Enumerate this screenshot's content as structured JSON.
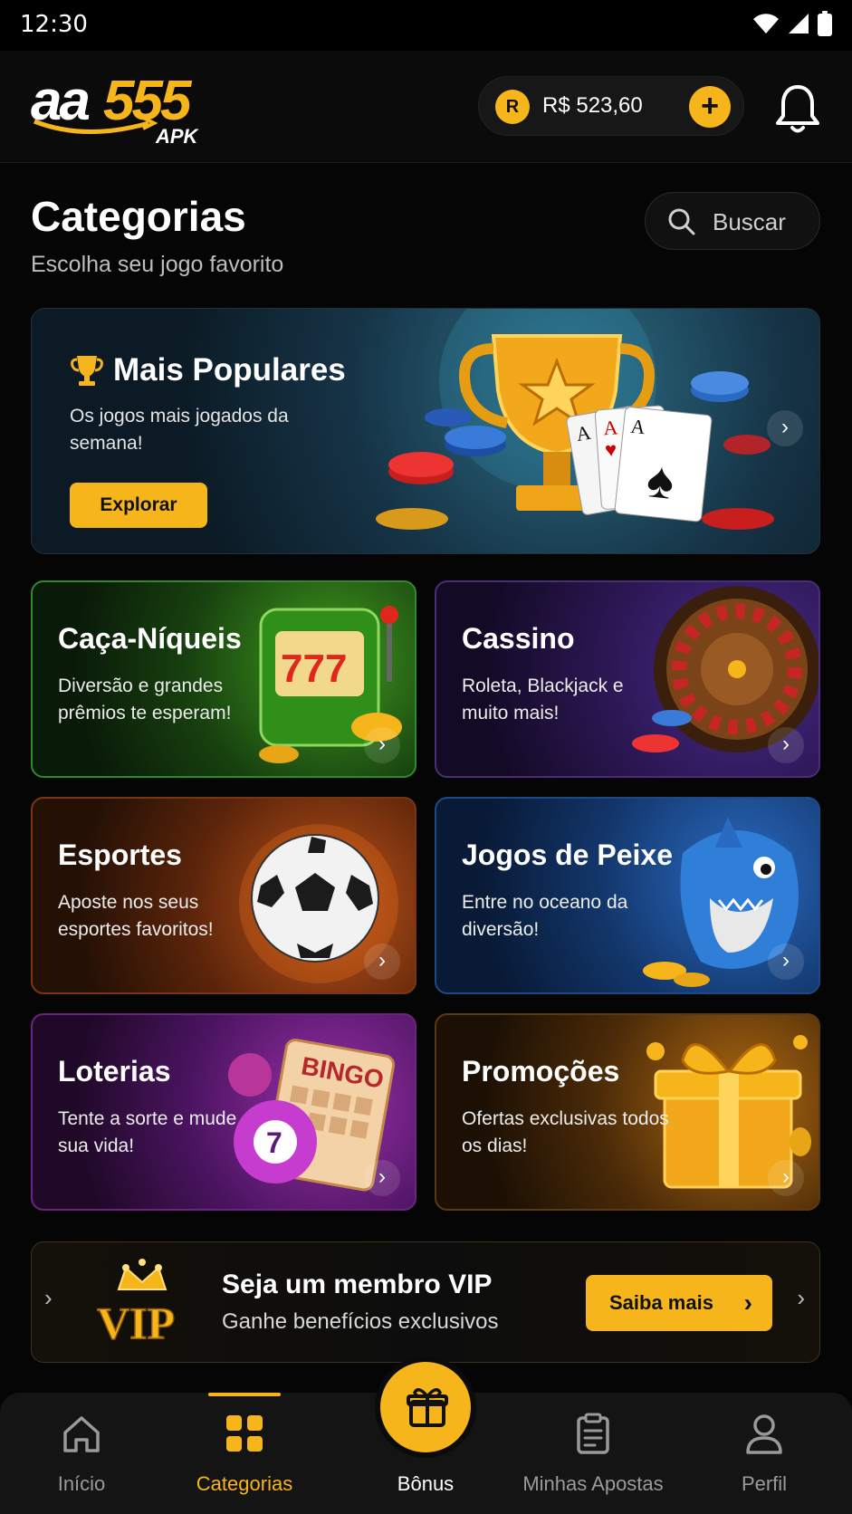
{
  "status_bar": {
    "time": "12:30"
  },
  "header": {
    "logo": {
      "part1": "aa",
      "part2": "555",
      "sub": "APK"
    },
    "balance": {
      "coin_letter": "R",
      "value": "R$ 523,60",
      "add_symbol": "+"
    }
  },
  "page": {
    "title": "Categorias",
    "subtitle": "Escolha seu jogo favorito"
  },
  "search": {
    "label": "Buscar"
  },
  "hero": {
    "title": "Mais Populares",
    "description": "Os jogos mais jogados da semana!",
    "button": "Explorar"
  },
  "categories": [
    {
      "title": "Caça-Níqueis",
      "description": "Diversão e grandes prêmios te esperam!"
    },
    {
      "title": "Cassino",
      "description": "Roleta, Blackjack e muito mais!"
    },
    {
      "title": "Esportes",
      "description": "Aposte nos seus esportes favoritos!"
    },
    {
      "title": "Jogos de Peixe",
      "description": "Entre no oceano da diversão!"
    },
    {
      "title": "Loterias",
      "description": "Tente a sorte e mude sua vida!"
    },
    {
      "title": "Promoções",
      "description": "Ofertas exclusivas todos os dias!"
    }
  ],
  "vip": {
    "badge": "VIP",
    "title": "Seja um membro VIP",
    "subtitle": "Ganhe benefícios exclusivos",
    "button": "Saiba mais"
  },
  "bottom_nav": [
    {
      "label": "Início",
      "icon": "home-icon"
    },
    {
      "label": "Categorias",
      "icon": "grid-icon",
      "active": true
    },
    {
      "label": "Bônus",
      "icon": "gift-icon"
    },
    {
      "label": "Minhas Apostas",
      "icon": "clipboard-icon"
    },
    {
      "label": "Perfil",
      "icon": "user-icon"
    }
  ],
  "colors": {
    "accent": "#f7b51c",
    "background": "#050505"
  }
}
